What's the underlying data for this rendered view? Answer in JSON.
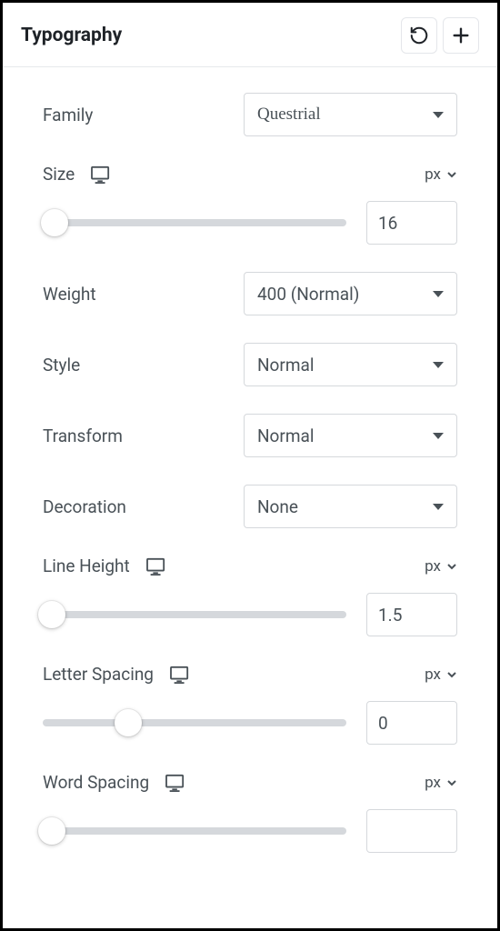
{
  "header": {
    "title": "Typography"
  },
  "family": {
    "label": "Family",
    "value": "Questrial"
  },
  "size": {
    "label": "Size",
    "unit": "px",
    "value": "16",
    "thumb_pct": 4
  },
  "weight": {
    "label": "Weight",
    "value": "400 (Normal)"
  },
  "style": {
    "label": "Style",
    "value": "Normal"
  },
  "transform": {
    "label": "Transform",
    "value": "Normal"
  },
  "decoration": {
    "label": "Decoration",
    "value": "None"
  },
  "lineHeight": {
    "label": "Line Height",
    "unit": "px",
    "value": "1.5",
    "thumb_pct": 3
  },
  "letterSpacing": {
    "label": "Letter Spacing",
    "unit": "px",
    "value": "0",
    "thumb_pct": 28
  },
  "wordSpacing": {
    "label": "Word Spacing",
    "unit": "px",
    "value": "",
    "thumb_pct": 3
  }
}
